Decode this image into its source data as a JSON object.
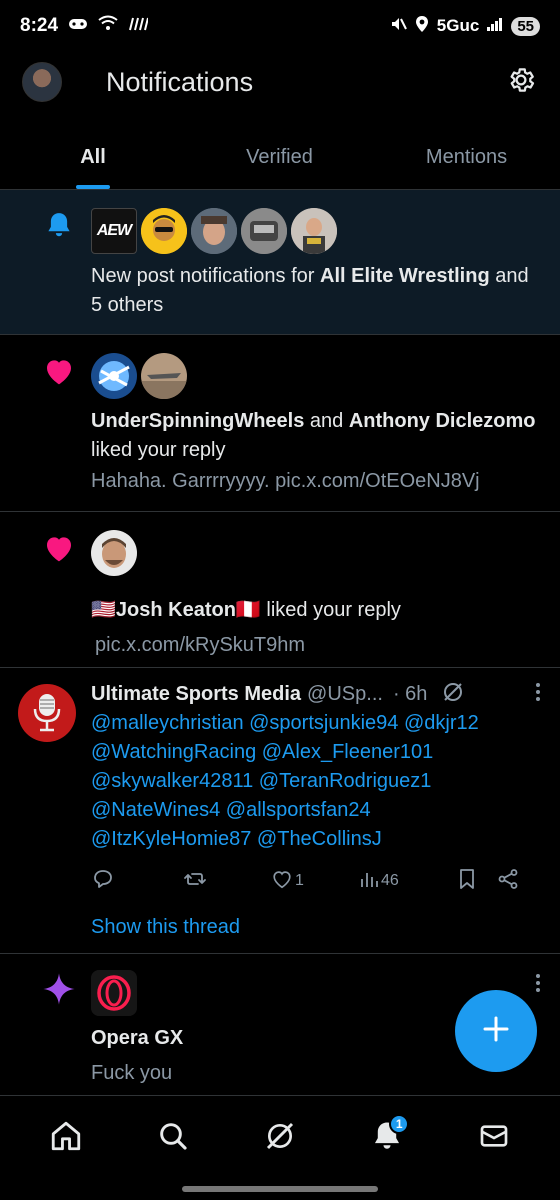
{
  "status_bar": {
    "time": "8:24",
    "network": "5Guc",
    "battery": "55"
  },
  "header": {
    "title": "Notifications"
  },
  "tabs": [
    {
      "label": "All",
      "active": true
    },
    {
      "label": "Verified",
      "active": false
    },
    {
      "label": "Mentions",
      "active": false
    }
  ],
  "notifications": {
    "n1": {
      "icon": "bell-icon",
      "avatar_labels": [
        "AEW"
      ],
      "text_pre": "New post notifications for ",
      "bold": "All Elite Wrestling",
      "text_post": " and 5 others"
    },
    "n2": {
      "icon": "heart-icon",
      "user1": "UnderSpinningWheels",
      "and": " and ",
      "user2": "Anthony Diclezomo",
      "action": " liked your reply",
      "reply_text": "Hahaha. Garrrryyyy. pic.x.com/OtEOeNJ8Vj"
    },
    "n3": {
      "icon": "heart-icon",
      "user": "🇺🇸Josh Keaton🇵🇪",
      "action": " liked your reply",
      "reply_text": "pic.x.com/kRySkuT9hm"
    },
    "tweet": {
      "name": "Ultimate Sports Media",
      "handle": "@USp...",
      "time": "· 6h",
      "mentions": [
        "@malleychristian @sportsjunkie94 @dkjr12",
        "@WatchingRacing @Alex_Fleener101",
        "@skywalker42811 @TeranRodriguez1",
        "@NateWines4 @allsportsfan24",
        "@ItzKyleHomie87 @TheCollinsJ"
      ],
      "likes": "1",
      "views": "46",
      "show_thread": "Show this thread"
    },
    "n5": {
      "icon": "sparkle-icon",
      "name": "Opera GX",
      "text": "Fuck you"
    }
  },
  "bottom_nav": {
    "notification_badge": "1"
  },
  "colors": {
    "accent": "#1d9bf0",
    "like": "#f91880",
    "background": "#000000",
    "highlight_row": "#0d1b26"
  }
}
